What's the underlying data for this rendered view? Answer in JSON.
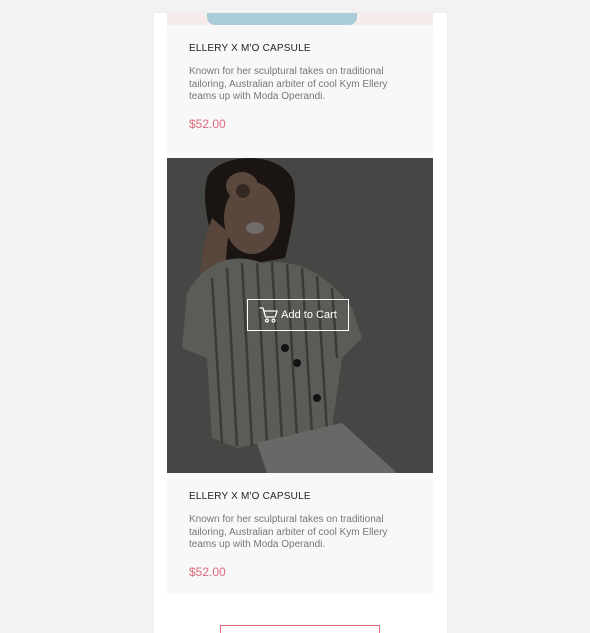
{
  "products": [
    {
      "title": "ELLERY X M'O CAPSULE",
      "description": "Known for her sculptural takes on traditional tailoring, Australian arbiter of cool Kym Ellery teams up with Moda Operandi.",
      "price": "$52.00"
    },
    {
      "title": "ELLERY X M'O CAPSULE",
      "description": "Known for her sculptural takes on traditional tailoring, Australian arbiter of cool Kym Ellery teams up with Moda Operandi.",
      "price": "$52.00",
      "add_to_cart_label": "Add to Cart",
      "add_to_cart_icon": "cart-icon"
    }
  ],
  "colors": {
    "price": "#e06a7e",
    "overlay": "rgba(0,0,0,0.55)",
    "card_background": "#f8f8f8",
    "page_background": "#f2f2f2"
  }
}
